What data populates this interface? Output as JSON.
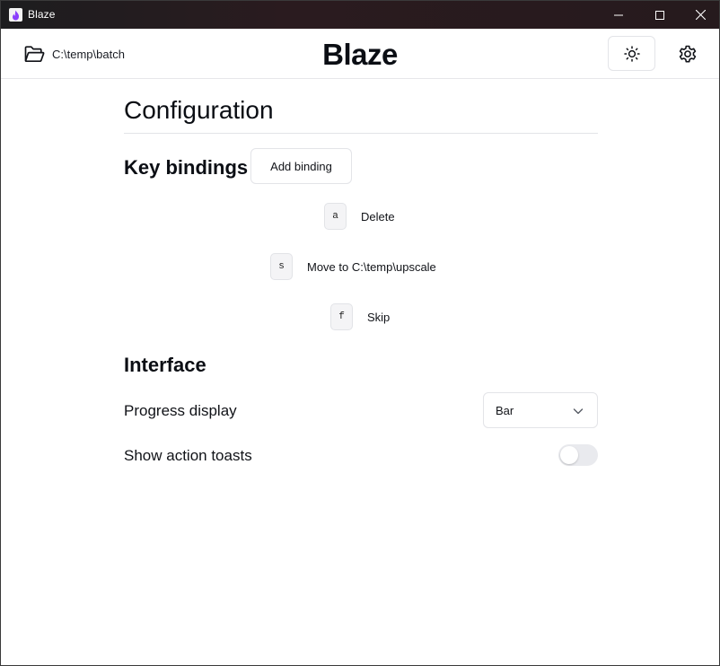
{
  "window": {
    "title": "Blaze",
    "icon": "flame-app-icon",
    "controls": [
      "minimize-icon",
      "maximize-icon",
      "close-icon"
    ]
  },
  "header": {
    "folder_path": "C:\\temp\\batch",
    "brand": "Blaze",
    "folder_icon": "folder-open-icon",
    "theme_icon": "sun-icon",
    "settings_icon": "gear-icon"
  },
  "config": {
    "title": "Configuration",
    "key_bindings": {
      "title": "Key bindings",
      "add_label": "Add binding",
      "items": [
        {
          "key": "a",
          "action": "Delete"
        },
        {
          "key": "s",
          "action": "Move to C:\\temp\\upscale"
        },
        {
          "key": "f",
          "action": "Skip"
        }
      ]
    },
    "interface": {
      "title": "Interface",
      "progress_display": {
        "label": "Progress display",
        "value": "Bar"
      },
      "show_action_toasts": {
        "label": "Show action toasts",
        "enabled": false
      }
    }
  },
  "colors": {
    "accent_flame": "#8a3ffc",
    "titlebar": "#1d1d1f",
    "text": "#111318"
  }
}
